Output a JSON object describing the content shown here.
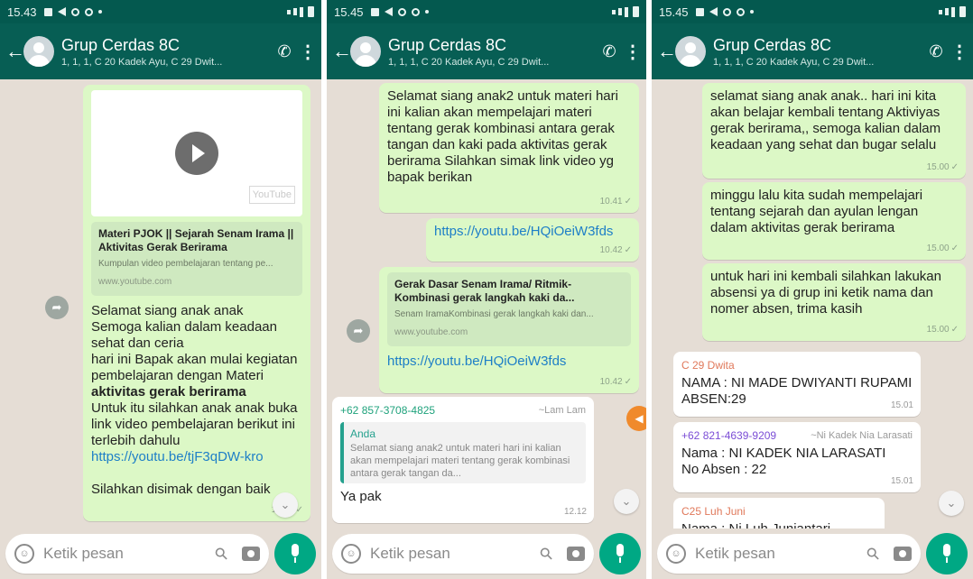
{
  "colors": {
    "header": "#075e54",
    "status_bar": "#04594f",
    "outgoing": "#dcf8c6",
    "incoming": "#ffffff",
    "wallpaper": "#e5ddd5",
    "link": "#1e7fc7",
    "mic": "#00a884"
  },
  "phones": [
    {
      "status_time": "15.43",
      "title": "Grup Cerdas 8C",
      "subtitle": "1, 1, 1, C 20 Kadek Ayu, C 29 Dwit...",
      "compose_placeholder": "Ketik pesan",
      "msg1": {
        "preview_title": "Materi PJOK || Sejarah Senam Irama || Aktivitas Gerak Berirama",
        "preview_desc": "Kumpulan video pembelajaran tentang pe...",
        "preview_domain": "www.youtube.com",
        "thumb_label": "YouTube",
        "line1": "Selamat siang anak anak",
        "line2": "Semoga kalian dalam keadaan sehat dan ceria",
        "line3": "hari ini Bapak akan mulai kegiatan pembelajaran dengan Materi",
        "bold": "aktivitas gerak berirama",
        "line4": "Untuk itu silahkan anak anak buka link video pembelajaran berikut ini terlebih dahulu",
        "link": "https://youtu.be/tjF3qDW-kro",
        "line5": "Silahkan disimak dengan baik",
        "time": "15.24"
      }
    },
    {
      "status_time": "15.45",
      "title": "Grup Cerdas 8C",
      "subtitle": "1, 1, 1, C 20 Kadek Ayu, C 29 Dwit...",
      "compose_placeholder": "Ketik pesan",
      "msg1": {
        "text": "Selamat siang anak2 untuk materi hari ini kalian akan mempelajari materi tentang gerak kombinasi antara gerak tangan dan kaki pada aktivitas gerak berirama Silahkan simak link video yg bapak berikan",
        "time": "10.41"
      },
      "msg2": {
        "link": "https://youtu.be/HQiOeiW3fds",
        "time": "10.42"
      },
      "msg3": {
        "preview_title": "Gerak Dasar Senam Irama/ Ritmik-Kombinasi gerak langkah kaki da...",
        "preview_desc": "Senam IramaKombinasi gerak langkah kaki dan...",
        "preview_domain": "www.youtube.com",
        "link": "https://youtu.be/HQiOeiW3fds",
        "time": "10.42"
      },
      "msg4": {
        "sender": "+62 857-3708-4825",
        "alias": "~Lam Lam",
        "quote_name": "Anda",
        "quote_text": "Selamat siang anak2 untuk materi hari ini kalian akan mempelajari materi tentang gerak kombinasi antara gerak tangan da...",
        "text": "Ya pak",
        "time": "12.12"
      }
    },
    {
      "status_time": "15.45",
      "title": "Grup Cerdas 8C",
      "subtitle": "1, 1, 1, C 20 Kadek Ayu, C 29 Dwit...",
      "compose_placeholder": "Ketik pesan",
      "msg1": {
        "text": "selamat siang anak anak.. hari ini kita akan belajar kembali tentang Aktiviyas gerak berirama,, semoga kalian dalam keadaan yang sehat dan bugar selalu",
        "time": "15.00"
      },
      "msg2": {
        "text": "minggu lalu kita sudah mempelajari tentang sejarah dan ayulan lengan dalam aktivitas gerak berirama",
        "time": "15.00"
      },
      "msg3": {
        "text": "untuk hari ini kembali silahkan lakukan absensi ya di grup ini ketik nama dan nomer absen, trima kasih",
        "time": "15.00"
      },
      "msg4": {
        "sender": "C 29 Dwita",
        "text": "NAMA : NI MADE DWIYANTI RUPAMI ABSEN:29",
        "time": "15.01"
      },
      "msg5": {
        "sender": "+62 821-4639-9209",
        "alias": "~Ni Kadek Nia Larasati",
        "line1": "Nama : NI KADEK NIA LARASATI",
        "line2": "No Absen : 22",
        "time": "15.01"
      },
      "msg6": {
        "sender": "C25 Luh Juni",
        "text": "Nama : Ni Luh Juniantari"
      }
    }
  ]
}
